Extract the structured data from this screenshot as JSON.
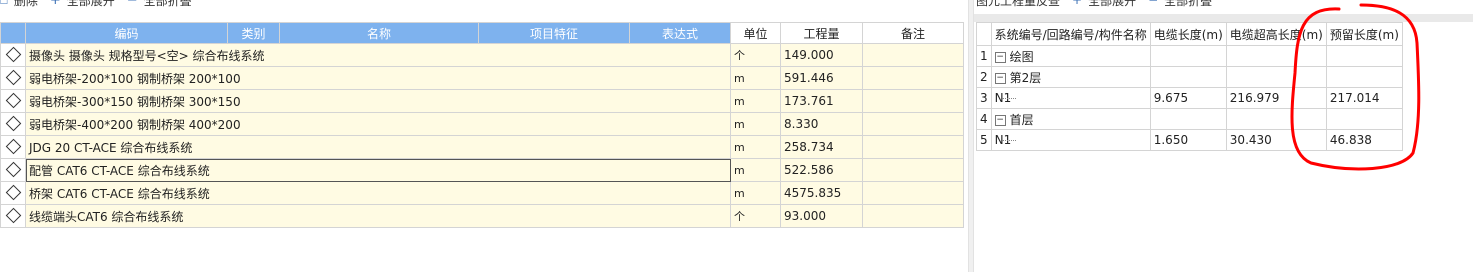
{
  "left_toolbar": {
    "delete_label": "删除",
    "expand_label": "全部展开",
    "collapse_label": "全部折叠"
  },
  "left_table": {
    "headers": {
      "code": "编码",
      "category": "类别",
      "name": "名称",
      "features": "项目特征",
      "expression": "表达式",
      "unit": "单位",
      "quantity": "工程量",
      "remark": "备注"
    },
    "rows": [
      {
        "name": "摄像头 摄像头 规格型号<空> 综合布线系统",
        "unit": "个",
        "quantity": "149.000"
      },
      {
        "name": "弱电桥架-200*100 钢制桥架 200*100",
        "unit": "m",
        "quantity": "591.446"
      },
      {
        "name": "弱电桥架-300*150 钢制桥架 300*150",
        "unit": "m",
        "quantity": "173.761"
      },
      {
        "name": "弱电桥架-400*200 钢制桥架 400*200",
        "unit": "m",
        "quantity": "8.330"
      },
      {
        "name": "JDG 20 CT-ACE 综合布线系统",
        "unit": "m",
        "quantity": "258.734"
      },
      {
        "name": "配管 CAT6 CT-ACE 综合布线系统",
        "unit": "m",
        "quantity": "522.586"
      },
      {
        "name": "桥架 CAT6 CT-ACE 综合布线系统",
        "unit": "m",
        "quantity": "4575.835"
      },
      {
        "name": "线缆端头CAT6 综合布线系统",
        "unit": "个",
        "quantity": "93.000"
      }
    ]
  },
  "right_toolbar": {
    "title": "图元工程量反查",
    "expand_label": "全部展开",
    "collapse_label": "全部折叠"
  },
  "right_table": {
    "headers": {
      "path": "系统编号/回路编号/构件名称",
      "cable_length": "电缆长度(m)",
      "cable_extra": "电缆超高长度(m)",
      "reserved": "预留长度(m)"
    },
    "rows": [
      {
        "idx": "1",
        "toggle": "−",
        "label": "绘图",
        "level": 1,
        "cable_length": "",
        "cable_extra": "",
        "reserved": ""
      },
      {
        "idx": "2",
        "toggle": "−",
        "label": "第2层",
        "level": 2,
        "cable_length": "",
        "cable_extra": "",
        "reserved": ""
      },
      {
        "idx": "3",
        "toggle": "",
        "label": "N1",
        "level": 3,
        "cable_length": "9.675",
        "cable_extra": "216.979",
        "reserved": "217.014"
      },
      {
        "idx": "4",
        "toggle": "−",
        "label": "首层",
        "level": 2,
        "cable_length": "",
        "cable_extra": "",
        "reserved": ""
      },
      {
        "idx": "5",
        "toggle": "",
        "label": "N1",
        "level": 3,
        "cable_length": "1.650",
        "cable_extra": "30.430",
        "reserved": "46.838"
      }
    ]
  },
  "annotation": {
    "color": "#ff0000"
  }
}
